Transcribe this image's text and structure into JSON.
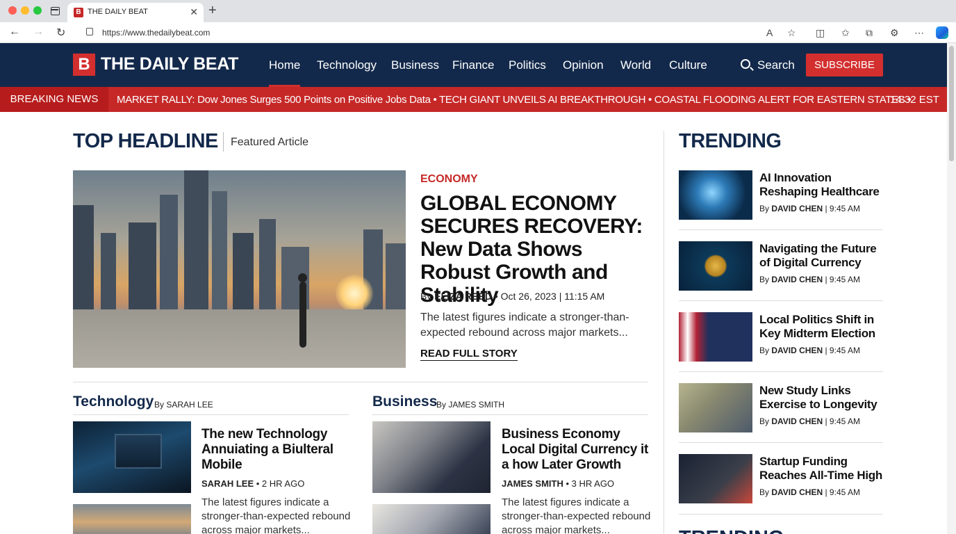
{
  "browser": {
    "tab_title": "THE DAILY BEAT",
    "tab_favicon": "B",
    "url": "https://www.thedailybeat.com"
  },
  "site": {
    "logo_letter": "B",
    "name": "THE DAILY BEAT",
    "nav": [
      "Home",
      "Technology",
      "Business",
      "Finance",
      "Politics",
      "Opinion",
      "World",
      "Culture"
    ],
    "search_label": "Search",
    "subscribe_label": "SUBSCRIBE",
    "accent_color": "#d32f2f",
    "header_color": "#13294b"
  },
  "breaking": {
    "label": "BREAKING NEWS",
    "ticker": "MARKET RALLY: Dow Jones Surges 500 Points on Positive Jobs Data  •  TECH GIANT UNVEILS AI BREAKTHROUGH  •  COASTAL FLOODING ALERT FOR EASTERN STATES  •",
    "time": "14:32 EST"
  },
  "main": {
    "section_title": "TOP HEADLINE",
    "section_sub": "Featured Article",
    "hero": {
      "category": "ECONOMY",
      "title": "GLOBAL ECONOMY SECURES RECOVERY: New Data Shows Robust Growth and Stability",
      "by": "By",
      "author": "ELIZA REED",
      "date": "• Oct 26, 2023 | 11:15 AM",
      "excerpt": "The latest figures indicate a stronger-than-expected rebound across major markets...",
      "read_more": "READ FULL STORY"
    },
    "columns": [
      {
        "heading": "Technology",
        "by": "By",
        "by_author": "SARAH LEE",
        "article": {
          "title": "The new Technology Annuiating a Biulteral Mobile",
          "author": "SARAH LEE",
          "time": "• 2 HR AGO",
          "excerpt": "The latest figures indicate a stronger-than-expected rebound across major markets..."
        }
      },
      {
        "heading": "Business",
        "by": "By",
        "by_author": "JAMES SMITH",
        "article": {
          "title": "Business Economy Local Digital Currency it a how Later Growth",
          "author": "JAMES SMITH",
          "time": "• 3 HR AGO",
          "excerpt": "The latest figures indicate a stronger-than-expected rebound across major markets..."
        }
      }
    ]
  },
  "trending": {
    "title": "TRENDING",
    "items": [
      {
        "title": "AI Innovation Reshaping Healthcare",
        "by": "By",
        "author": "DAVID CHEN",
        "time": "| 9:45 AM"
      },
      {
        "title": "Navigating the Future of Digital Currency",
        "by": "By",
        "author": "DAVID CHEN",
        "time": "| 9:45 AM"
      },
      {
        "title": "Local Politics Shift in Key Midterm Election",
        "by": "By",
        "author": "DAVID CHEN",
        "time": "| 9:45 AM"
      },
      {
        "title": "New Study Links Exercise to Longevity",
        "by": "By",
        "author": "DAVID CHEN",
        "time": "| 9:45 AM"
      },
      {
        "title": "Startup Funding Reaches All-Time High",
        "by": "By",
        "author": "DAVID CHEN",
        "time": "| 9:45 AM"
      }
    ],
    "title_repeat": "TRENDING"
  }
}
